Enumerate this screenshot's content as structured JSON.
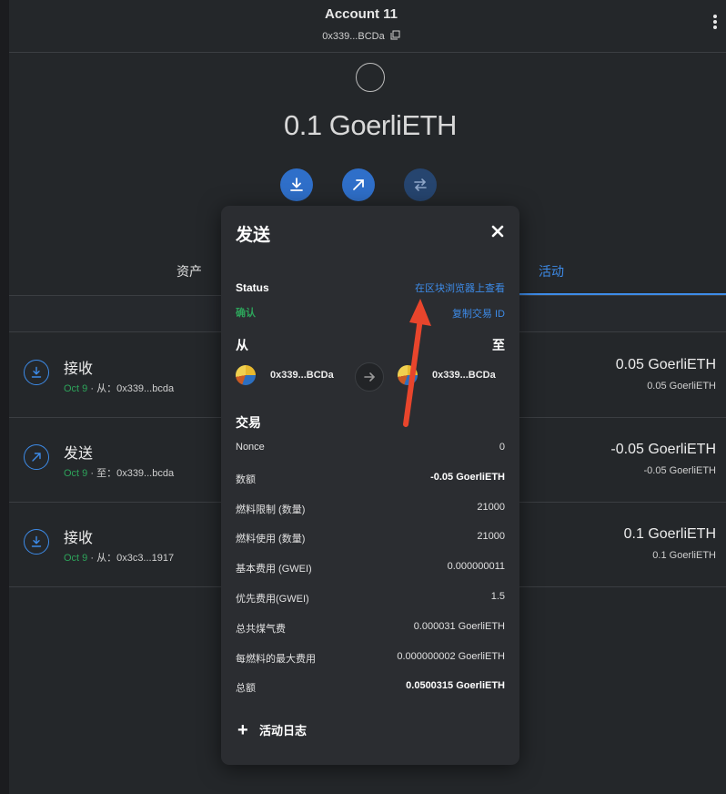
{
  "header": {
    "account_name": "Account 11",
    "account_address": "0x339...BCDa"
  },
  "balance": "0.1 GoerliETH",
  "tabs": {
    "assets": "资产",
    "activity": "活动"
  },
  "activity": [
    {
      "title": "接收",
      "date": "Oct 9",
      "sub": "· 从：0x339...bcda",
      "amount": "0.05 GoerliETH",
      "amount_fiat": "0.05 GoerliETH",
      "icon": "receive-icon"
    },
    {
      "title": "发送",
      "date": "Oct 9",
      "sub": "· 至：0x339...bcda",
      "amount": "-0.05 GoerliETH",
      "amount_fiat": "-0.05 GoerliETH",
      "icon": "send-icon"
    },
    {
      "title": "接收",
      "date": "Oct 9",
      "sub": "· 从：0x3c3...1917",
      "amount": "0.1 GoerliETH",
      "amount_fiat": "0.1 GoerliETH",
      "icon": "receive-icon"
    }
  ],
  "modal": {
    "title": "发送",
    "status_label": "Status",
    "view_explorer": "在区块浏览器上查看",
    "status_value": "确认",
    "copy_tx_id": "复制交易 ID",
    "from_label": "从",
    "to_label": "至",
    "from_address": "0x339...BCDa",
    "to_address": "0x339...BCDa",
    "tx_section": "交易",
    "rows": [
      {
        "key": "Nonce",
        "value": "0"
      },
      {
        "key": "数额",
        "value": "-0.05 GoerliETH"
      },
      {
        "key": "燃料限制 (数量)",
        "value": "21000"
      },
      {
        "key": "燃料使用 (数量)",
        "value": "21000"
      },
      {
        "key": "基本费用 (GWEI)",
        "value": "0.000000011"
      },
      {
        "key": "优先费用(GWEI)",
        "value": "1.5"
      },
      {
        "key": "总共煤气费",
        "value": "0.000031 GoerliETH"
      },
      {
        "key": "每燃料的最大费用",
        "value": "0.000000002 GoerliETH"
      },
      {
        "key": "总额",
        "value": "0.0500315 GoerliETH"
      }
    ],
    "activity_log": "活动日志"
  },
  "colors": {
    "accent": "#3d8be8",
    "success": "#2da35a",
    "annotation": "#e8452c"
  }
}
